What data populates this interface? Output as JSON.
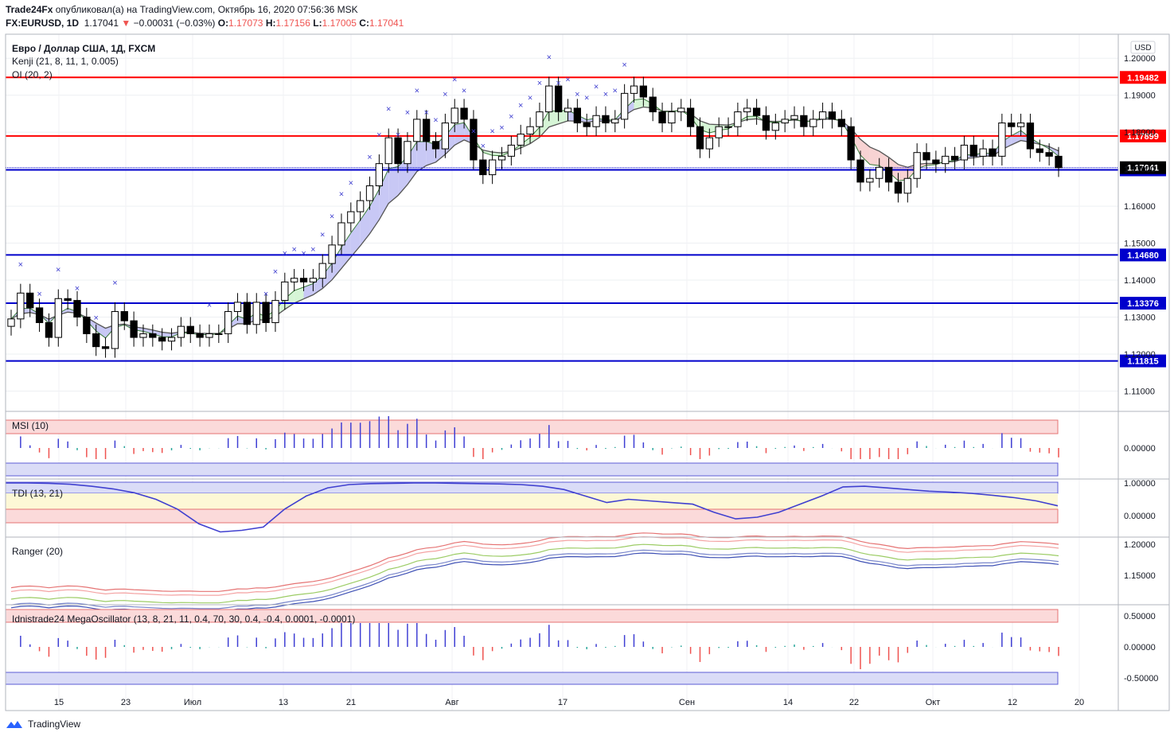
{
  "header": {
    "publisher": "Trade24Fx",
    "published_text": "опубликовал(а) на TradingView.com, Октябрь 16, 2020 07:56:36 MSK",
    "symbol": "FX:EURUSD, 1D",
    "last": "1.17041",
    "change": "−0.00031 (−0.03%)",
    "o_label": "O:",
    "o_value": "1.17073",
    "h_label": "H:",
    "h_value": "1.17156",
    "l_label": "L:",
    "l_value": "1.17005",
    "c_label": "C:",
    "c_value": "1.17041"
  },
  "legend": {
    "main_title": "Евро / Доллар США, 1Д, FXCM",
    "kenji": "Kenji (21, 8, 11, 1, 0.005)",
    "oi": "OI (20, 2)",
    "currency": "USD"
  },
  "panes": {
    "msi": "MSI (10)",
    "tdi": "TDI (13, 21)",
    "ranger": "Ranger (20)",
    "mega": "Idnistrade24 MegaOscillator (13, 8, 21, 11, 0.4, 70, 30, 0.4, -0.4, 0.0001, -0.0001)"
  },
  "footer": {
    "brand": "TradingView"
  },
  "colors": {
    "up": "#ffffff",
    "down": "#000000",
    "red_level": "#ff0000",
    "blue_level": "#0000cc",
    "blue_band": "#c8c8f5",
    "green_band": "#d6f5d6",
    "red_band": "#f8d3d3",
    "bar_blue": "#3f3fd4",
    "bar_red": "#ef5350",
    "bar_green": "#26a69a"
  },
  "chart_data": {
    "type": "candlestick",
    "title": "Евро / Доллар США, 1Д, FXCM",
    "x_tick_labels": [
      "15",
      "23",
      "Июл",
      "13",
      "21",
      "Авг",
      "17",
      "Сен",
      "14",
      "22",
      "Окт",
      "12",
      "20"
    ],
    "y_tick_labels": [
      "1.20000",
      "1.19000",
      "1.18000",
      "1.17000",
      "1.16000",
      "1.15000",
      "1.14000",
      "1.13000",
      "1.12000",
      "1.11000"
    ],
    "ylim": [
      1.1045,
      1.2065
    ],
    "levels": [
      {
        "value": 1.19482,
        "label": "1.19482",
        "color": "#ff0000"
      },
      {
        "value": 1.17899,
        "label": "1.17899",
        "color": "#ff0000"
      },
      {
        "value": 1.16982,
        "label": "1.16982",
        "color": "#0000cc"
      },
      {
        "value": 1.1468,
        "label": "1.14680",
        "color": "#0000cc"
      },
      {
        "value": 1.13376,
        "label": "1.13376",
        "color": "#0000cc"
      },
      {
        "value": 1.11815,
        "label": "1.11815",
        "color": "#0000cc"
      }
    ],
    "last_price": {
      "value": 1.17041,
      "label": "1.17041"
    },
    "close": [
      1.1295,
      1.1365,
      1.1325,
      1.1285,
      1.1245,
      1.135,
      1.1345,
      1.13,
      1.1255,
      1.122,
      1.1215,
      1.1315,
      1.129,
      1.1245,
      1.1255,
      1.1245,
      1.1235,
      1.1245,
      1.1275,
      1.1255,
      1.1245,
      1.1255,
      1.1255,
      1.1315,
      1.134,
      1.128,
      1.134,
      1.1285,
      1.1345,
      1.1395,
      1.1405,
      1.1395,
      1.1405,
      1.1445,
      1.1495,
      1.1555,
      1.1585,
      1.1615,
      1.1655,
      1.1715,
      1.1785,
      1.1715,
      1.1775,
      1.1835,
      1.1775,
      1.1755,
      1.1825,
      1.1865,
      1.1835,
      1.1725,
      1.1685,
      1.1725,
      1.1735,
      1.1765,
      1.1795,
      1.1815,
      1.1855,
      1.1925,
      1.1855,
      1.1865,
      1.1825,
      1.1815,
      1.1845,
      1.1825,
      1.1835,
      1.1905,
      1.1925,
      1.1895,
      1.1855,
      1.1825,
      1.1855,
      1.1865,
      1.1815,
      1.1755,
      1.1785,
      1.1815,
      1.1815,
      1.1855,
      1.1865,
      1.1845,
      1.1805,
      1.1825,
      1.1835,
      1.1845,
      1.1815,
      1.1835,
      1.1855,
      1.1835,
      1.1815,
      1.1725,
      1.1665,
      1.1675,
      1.1705,
      1.1665,
      1.1635,
      1.1675,
      1.1745,
      1.1725,
      1.1715,
      1.1735,
      1.1725,
      1.1765,
      1.1735,
      1.1755,
      1.1735,
      1.1825,
      1.1815,
      1.1825,
      1.1755,
      1.1745,
      1.1735,
      1.17041
    ],
    "tdi_fast_approx": [
      1.0,
      1.0,
      0.99,
      0.96,
      0.9,
      0.82,
      0.7,
      0.5,
      0.2,
      -0.25,
      -0.5,
      -0.45,
      -0.35,
      0.2,
      0.6,
      0.85,
      0.95,
      0.98,
      0.99,
      1.0,
      1.0,
      0.99,
      0.98,
      0.97,
      0.95,
      0.9,
      0.8,
      0.6,
      0.4,
      0.5,
      0.45,
      0.4,
      0.35,
      0.1,
      -0.1,
      -0.05,
      0.1,
      0.35,
      0.6,
      0.88,
      0.9,
      0.85,
      0.8,
      0.75,
      0.72,
      0.68,
      0.62,
      0.55,
      0.45,
      0.3
    ]
  }
}
